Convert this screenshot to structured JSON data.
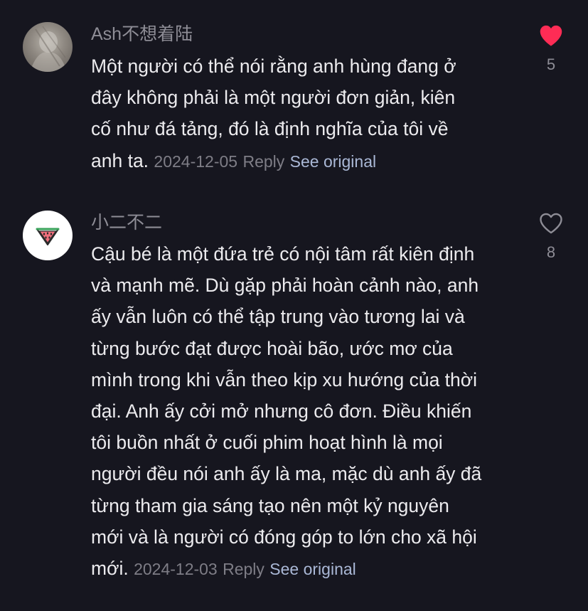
{
  "comments": [
    {
      "username": "Ash不想着陆",
      "lines": [
        "Một người có thể nói rằng anh hùng đang ở",
        "đây không phải là một người đơn giản, kiên",
        "cố như đá tảng, đó là định nghĩa của tôi về"
      ],
      "last_line": "anh ta.",
      "date": "2024-12-05",
      "reply_label": "Reply",
      "see_original_label": "See original",
      "likes": "5",
      "liked": true,
      "avatar_icon": "photo-avatar"
    },
    {
      "username": "小二不二",
      "lines": [
        "Cậu bé là một đứa trẻ có nội tâm rất kiên định",
        "và mạnh mẽ. Dù gặp phải hoàn cảnh nào, anh",
        "ấy vẫn luôn có thể tập trung vào tương lai và",
        "từng bước đạt được hoài bão, ước mơ của",
        "mình trong khi vẫn theo kịp xu hướng của thời",
        "đại. Anh ấy cởi mở nhưng cô đơn. Điều khiến",
        "tôi buồn nhất ở cuối phim hoạt hình là mọi",
        "người đều nói anh ấy là ma, mặc dù anh ấy đã",
        "từng tham gia sáng tạo nên một kỷ nguyên",
        "mới và là người có đóng góp to lớn cho xã hội"
      ],
      "last_line": "mới.",
      "date": "2024-12-03",
      "reply_label": "Reply",
      "see_original_label": "See original",
      "likes": "8",
      "liked": false,
      "avatar_icon": "watermelon-icon"
    }
  ],
  "colors": {
    "background": "#16161f",
    "text": "#ecebee",
    "muted": "#8e8d96",
    "link": "#aab8d6",
    "like_active": "#fe2c55"
  }
}
